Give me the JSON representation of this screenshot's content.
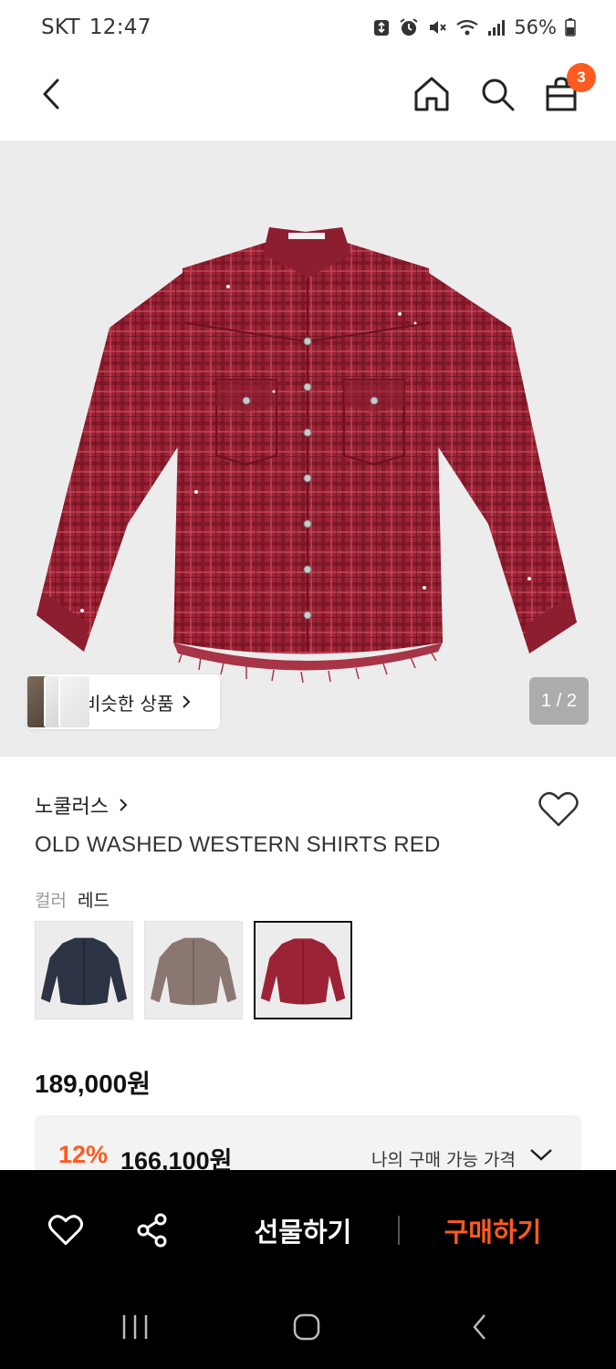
{
  "status_bar": {
    "carrier": "SKT",
    "time": "12:47",
    "battery": "56%",
    "icons": [
      "recycle-icon",
      "alarm-icon",
      "mute-icon",
      "wifi-icon",
      "signal-icon",
      "battery-icon"
    ]
  },
  "nav": {
    "cart_count": "3",
    "icons": [
      "back-icon",
      "home-icon",
      "search-icon",
      "shopping-bag-icon"
    ]
  },
  "gallery": {
    "similar_label": "비슷한 상품",
    "page_indicator": "1 / 2",
    "current_page": 1,
    "total_pages": 2
  },
  "product": {
    "brand": "노쿨러스",
    "name": "OLD WASHED WESTERN SHIRTS RED",
    "color_key": "컬러",
    "color_value": "레드",
    "swatches": [
      "navy",
      "grey-brown",
      "red"
    ],
    "selected_swatch": "red",
    "original_price": "189,000원",
    "discount_rate": "12%",
    "sale_price": "166,100원",
    "my_price_label": "나의 구매 가능 가격"
  },
  "bottom_bar": {
    "gift_label": "선물하기",
    "buy_label": "구매하기"
  },
  "colors": {
    "accent": "#ff5a1f",
    "shirt_red": "#9b2335",
    "shirt_navy": "#2c3345",
    "shirt_greybrown": "#8b7772"
  }
}
